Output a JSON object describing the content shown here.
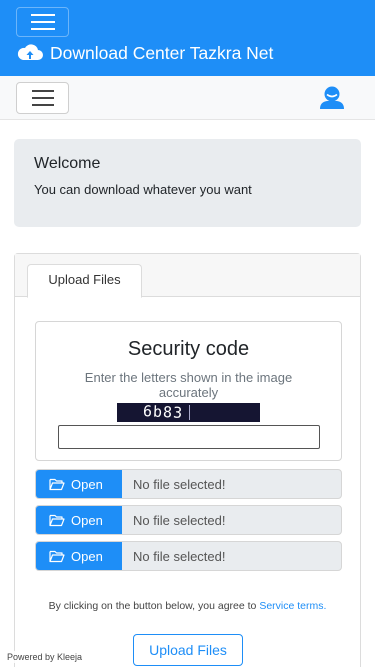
{
  "navbar": {
    "brand_title": "Download Center Tazkra Net",
    "menu_icon": "hamburger-icon",
    "brand_icon": "cloud-upload-icon",
    "accent_color": "#1e8ef7"
  },
  "subnav": {
    "menu_icon": "hamburger-icon",
    "user_icon": "user-icon"
  },
  "welcome": {
    "title": "Welcome",
    "text": "You can download whatever you want"
  },
  "upload_card": {
    "tab_label": "Upload Files",
    "security": {
      "title": "Security code",
      "description": "Enter the letters shown in the image accurately",
      "captcha_text": "6b83",
      "input_value": ""
    },
    "file_inputs": [
      {
        "button_label": "Open",
        "status": "No file selected!",
        "icon": "folder-open-icon"
      },
      {
        "button_label": "Open",
        "status": "No file selected!",
        "icon": "folder-open-icon"
      },
      {
        "button_label": "Open",
        "status": "No file selected!",
        "icon": "folder-open-icon"
      }
    ],
    "agree_text": "By clicking on the button below, you agree to",
    "agree_link": "Service terms.",
    "submit_label": "Upload Files"
  },
  "footer": {
    "powered_by": "Powered by Kleeja"
  }
}
